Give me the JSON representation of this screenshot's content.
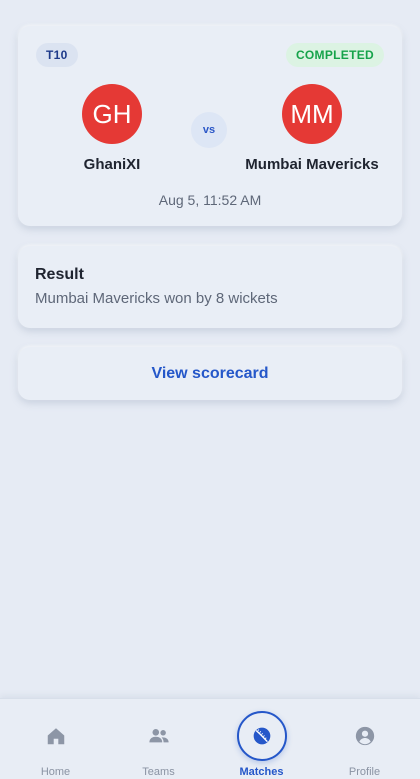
{
  "match": {
    "format": "T10",
    "status": "COMPLETED",
    "home": {
      "initials": "GH",
      "name": "GhaniXI"
    },
    "away": {
      "initials": "MM",
      "name": "Mumbai Mavericks"
    },
    "vs_label": "vs",
    "datetime": "Aug 5, 11:52 AM"
  },
  "result": {
    "title": "Result",
    "text": "Mumbai Mavericks won by 8 wickets"
  },
  "scorecard": {
    "label": "View scorecard"
  },
  "nav": {
    "items": [
      {
        "label": "Home",
        "icon": "home-icon"
      },
      {
        "label": "Teams",
        "icon": "teams-icon"
      },
      {
        "label": "Matches",
        "icon": "cricket-ball-icon",
        "active": true
      },
      {
        "label": "Profile",
        "icon": "profile-icon"
      }
    ]
  },
  "colors": {
    "accent": "#2557c9",
    "avatar": "#e53935",
    "completed": "#16a34a",
    "background": "#e6ebf4"
  }
}
